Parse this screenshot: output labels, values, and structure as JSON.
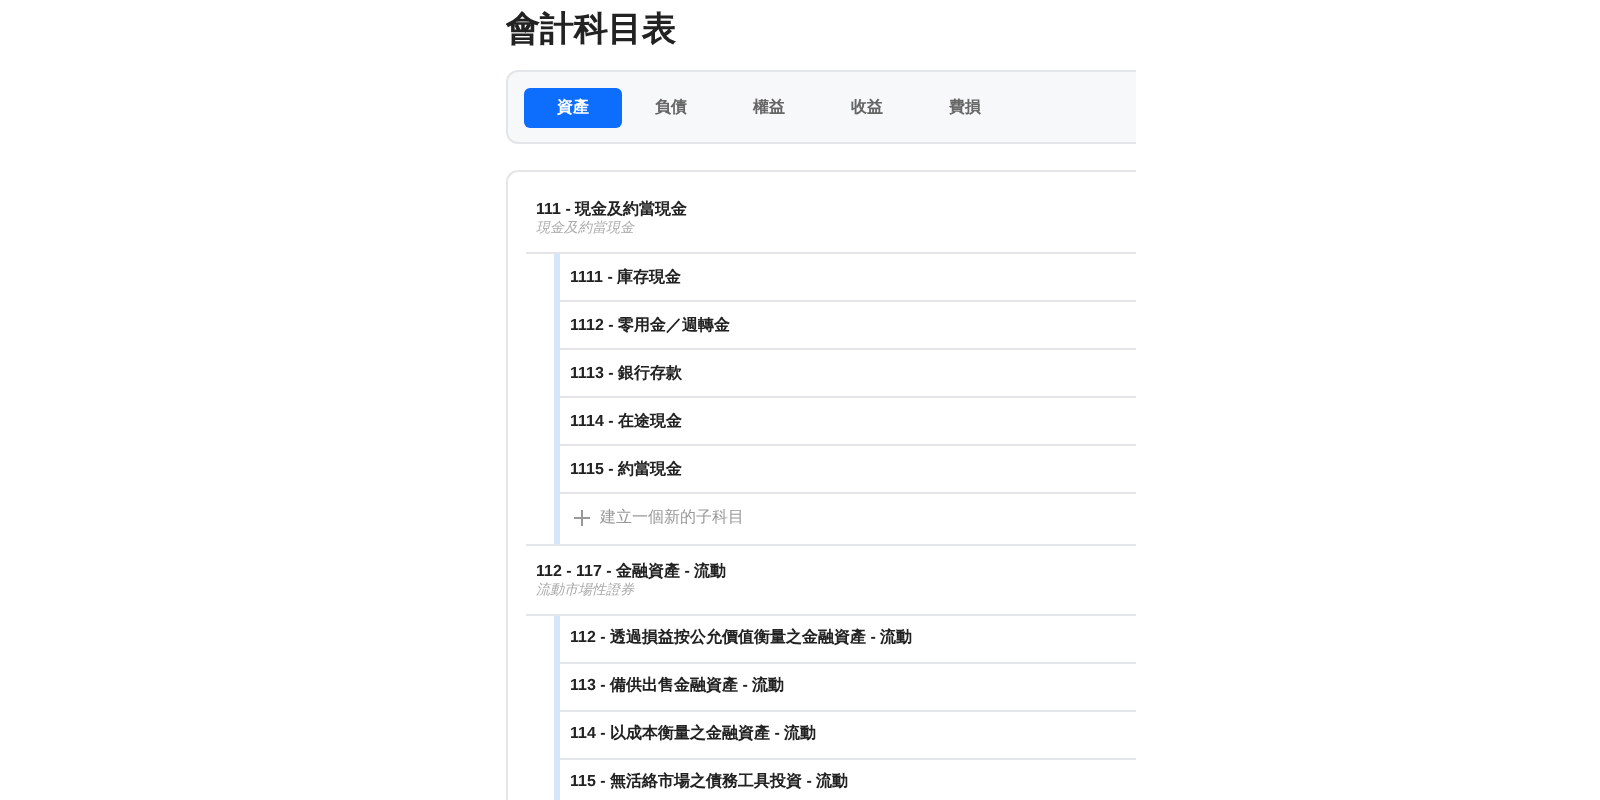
{
  "title": "會計科目表",
  "tabs": [
    {
      "label": "資產",
      "selected": true
    },
    {
      "label": "負債",
      "selected": false
    },
    {
      "label": "權益",
      "selected": false
    },
    {
      "label": "收益",
      "selected": false
    },
    {
      "label": "費損",
      "selected": false
    }
  ],
  "groups": [
    {
      "name": "111 - 現金及約當現金",
      "description": "現金及約當現金",
      "children": [
        "1111 - 庫存現金",
        "1112 - 零用金／週轉金",
        "1113 - 銀行存款",
        "1114 - 在途現金",
        "1115 - 約當現金"
      ],
      "add_label": "建立一個新的子科目"
    },
    {
      "name": "112 - 117 - 金融資產 - 流動",
      "description": "流動市場性證券",
      "children": [
        "112 - 透過損益按公允價值衡量之金融資產 - 流動",
        "113 - 備供出售金融資產 - 流動",
        "114 - 以成本衡量之金融資產 - 流動",
        "115 - 無活絡市場之債務工具投資 - 流動"
      ]
    }
  ]
}
